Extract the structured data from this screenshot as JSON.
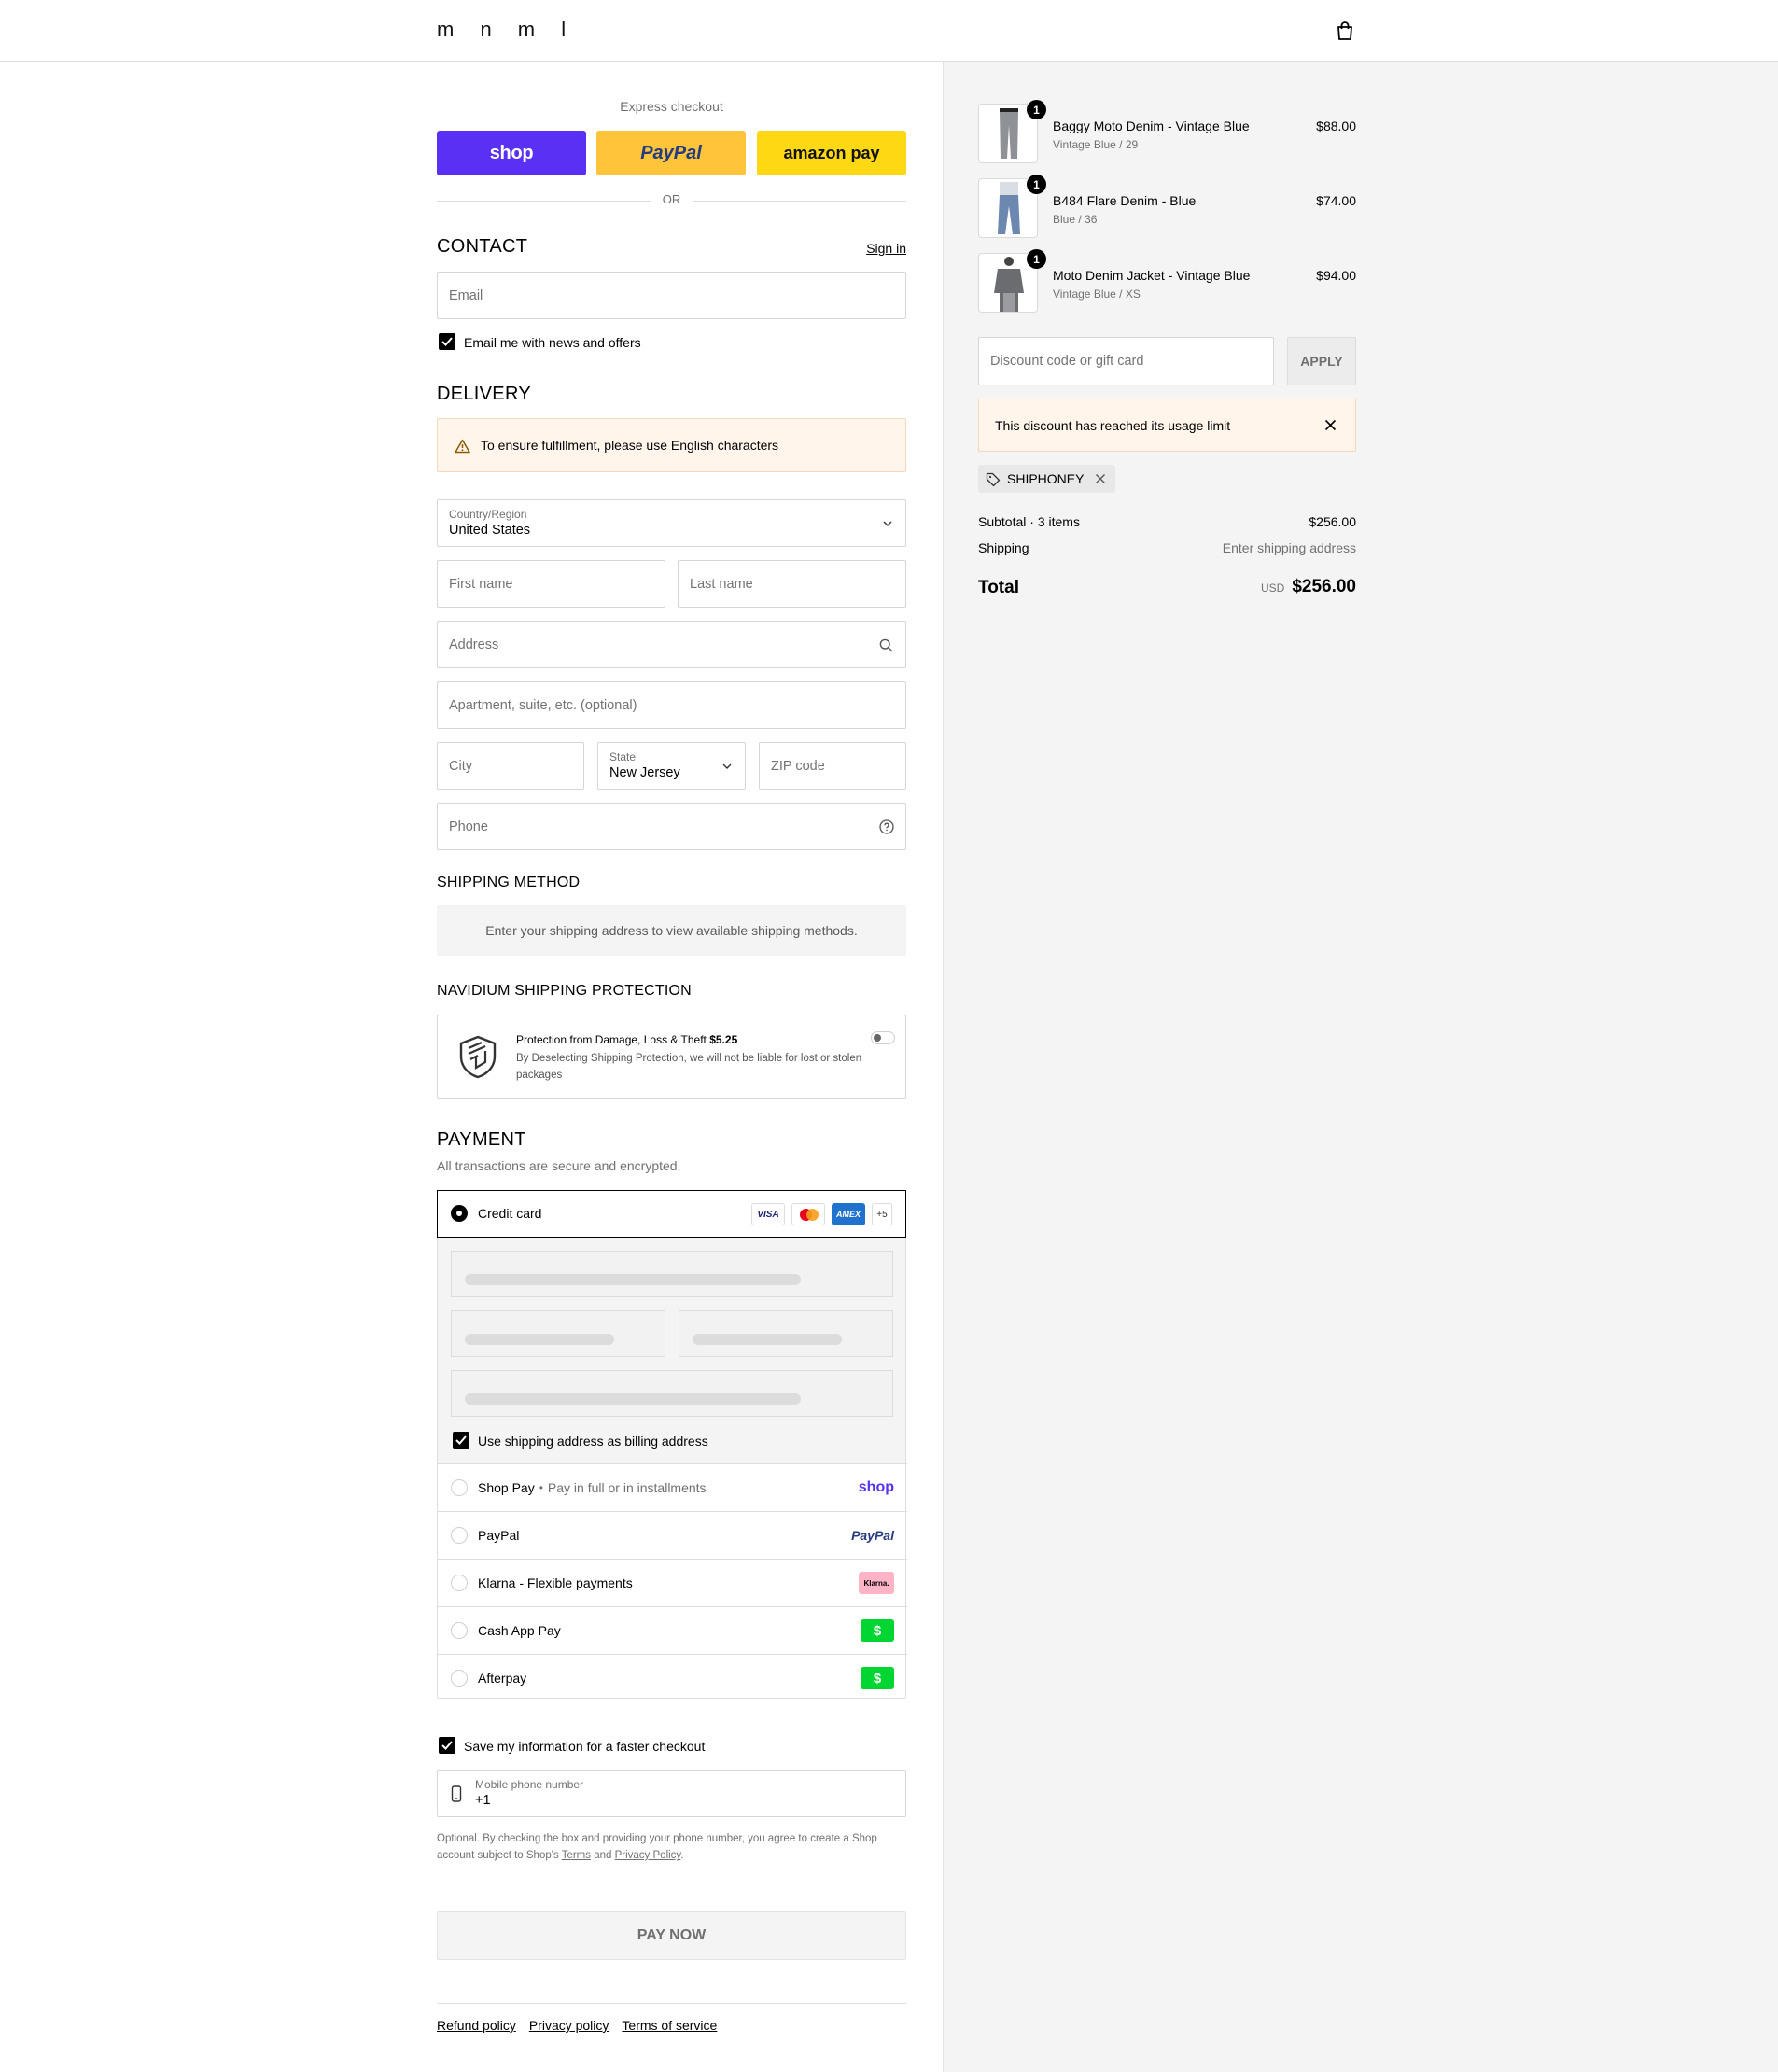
{
  "header": {
    "logo": "m n m l",
    "cart_icon": "shopping-bag-icon"
  },
  "express": {
    "title": "Express checkout",
    "shop_label": "shop",
    "paypal_label": "PayPal",
    "amazon_label": "amazon pay",
    "or_label": "OR",
    "colors": {
      "shop": "#5a31f4",
      "paypal": "#ffc439",
      "amazon": "#ffd814"
    }
  },
  "contact": {
    "title": "CONTACT",
    "sign_in": "Sign in",
    "email_placeholder": "Email",
    "news_label": "Email me with news and offers",
    "news_checked": true
  },
  "delivery": {
    "title": "DELIVERY",
    "warning": "To ensure fulfillment, please use English characters",
    "country_label": "Country/Region",
    "country_value": "United States",
    "first_name_placeholder": "First name",
    "last_name_placeholder": "Last name",
    "address_placeholder": "Address",
    "apartment_placeholder": "Apartment, suite, etc. (optional)",
    "city_placeholder": "City",
    "state_label": "State",
    "state_value": "New Jersey",
    "zip_placeholder": "ZIP code",
    "phone_placeholder": "Phone"
  },
  "shipping_method": {
    "title": "SHIPPING METHOD",
    "message": "Enter your shipping address to view available shipping methods."
  },
  "protection": {
    "title": "NAVIDIUM SHIPPING PROTECTION",
    "headline": "Protection from Damage, Loss & Theft",
    "price": "$5.25",
    "description": "By Deselecting Shipping Protection, we will not be liable for lost or stolen packages",
    "enabled": false
  },
  "payment": {
    "title": "PAYMENT",
    "subtitle": "All transactions are secure and encrypted.",
    "credit_card_label": "Credit card",
    "card_badges": [
      "VISA",
      "mastercard",
      "AMEX",
      "+5"
    ],
    "billing_label": "Use shipping address as billing address",
    "billing_checked": true,
    "options": [
      {
        "label": "Shop Pay",
        "sub": "Pay in full or in installments",
        "logo": "shop"
      },
      {
        "label": "PayPal",
        "sub": "",
        "logo": "PayPal"
      },
      {
        "label": "Klarna - Flexible payments",
        "sub": "",
        "logo": "Klarna."
      },
      {
        "label": "Cash App Pay",
        "sub": "",
        "logo": "$"
      },
      {
        "label": "Afterpay",
        "sub": "",
        "logo": "$"
      }
    ]
  },
  "save_info": {
    "label": "Save my information for a faster checkout",
    "checked": true,
    "phone_label": "Mobile phone number",
    "phone_value": "+1",
    "legal_prefix": "Optional. By checking the box and providing your phone number, you agree to create a Shop account subject to Shop's",
    "terms_link": "Terms",
    "and_text": "and",
    "privacy_link": "Privacy Policy",
    "legal_suffix": "."
  },
  "pay_now": "PAY NOW",
  "footer_links": [
    "Refund policy",
    "Privacy policy",
    "Terms of service"
  ],
  "summary": {
    "items": [
      {
        "name": "Baggy Moto Denim - Vintage Blue",
        "variant": "Vintage Blue / 29",
        "price": "$88.00",
        "qty": "1"
      },
      {
        "name": "B484 Flare Denim - Blue",
        "variant": "Blue / 36",
        "price": "$74.00",
        "qty": "1"
      },
      {
        "name": "Moto Denim Jacket - Vintage Blue",
        "variant": "Vintage Blue / XS",
        "price": "$94.00",
        "qty": "1"
      }
    ],
    "discount_placeholder": "Discount code or gift card",
    "apply_label": "APPLY",
    "discount_error": "This discount has reached its usage limit",
    "code_tag": "SHIPHONEY",
    "subtotal_label": "Subtotal · 3 items",
    "subtotal_value": "$256.00",
    "shipping_label": "Shipping",
    "shipping_value": "Enter shipping address",
    "total_label": "Total",
    "currency": "USD",
    "total_value": "$256.00"
  }
}
